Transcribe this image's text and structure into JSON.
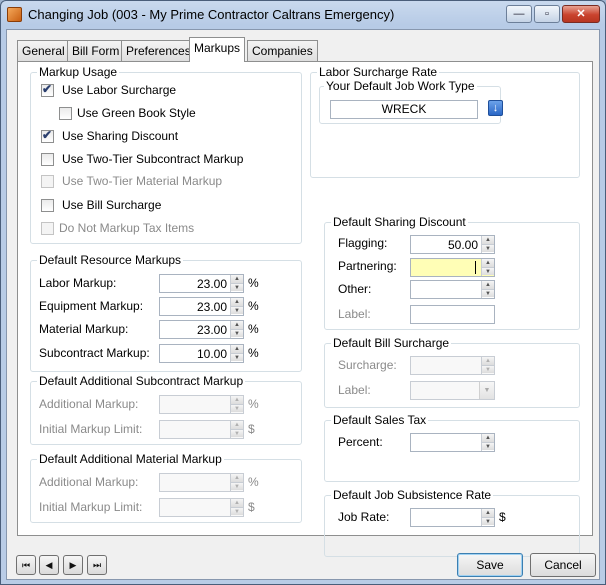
{
  "window": {
    "title": "Changing Job  (003 - My Prime Contractor Caltrans Emergency)",
    "minimize_glyph": "—",
    "maximize_glyph": "▫",
    "close_glyph": "✕"
  },
  "tabs": [
    {
      "label": "General",
      "active": false
    },
    {
      "label": "Bill Form",
      "active": false
    },
    {
      "label": "Preferences",
      "active": false
    },
    {
      "label": "Markups",
      "active": true
    },
    {
      "label": "Companies",
      "active": false
    }
  ],
  "markup_usage": {
    "legend": "Markup Usage",
    "items": [
      {
        "label": "Use Labor Surcharge",
        "checked": true,
        "enabled": true
      },
      {
        "label": "Use Green Book Style",
        "checked": false,
        "enabled": true
      },
      {
        "label": "Use Sharing Discount",
        "checked": true,
        "enabled": true
      },
      {
        "label": "Use Two-Tier Subcontract Markup",
        "checked": false,
        "enabled": true
      },
      {
        "label": "Use Two-Tier Material Markup",
        "checked": false,
        "enabled": false
      },
      {
        "label": "Use Bill Surcharge",
        "checked": false,
        "enabled": true
      },
      {
        "label": "Do Not Markup Tax Items",
        "checked": false,
        "enabled": false
      }
    ]
  },
  "resource_markups": {
    "legend": "Default Resource Markups",
    "rows": [
      {
        "label": "Labor Markup:",
        "value": "23.00",
        "unit": "%"
      },
      {
        "label": "Equipment Markup:",
        "value": "23.00",
        "unit": "%"
      },
      {
        "label": "Material Markup:",
        "value": "23.00",
        "unit": "%"
      },
      {
        "label": "Subcontract Markup:",
        "value": "10.00",
        "unit": "%"
      }
    ]
  },
  "additional_subcontract": {
    "legend": "Default Additional Subcontract Markup",
    "rows": [
      {
        "label": "Additional Markup:",
        "value": "",
        "unit": "%"
      },
      {
        "label": "Initial Markup Limit:",
        "value": "",
        "unit": "$"
      }
    ]
  },
  "additional_material": {
    "legend": "Default Additional Material Markup",
    "rows": [
      {
        "label": "Additional Markup:",
        "value": "",
        "unit": "%"
      },
      {
        "label": "Initial Markup Limit:",
        "value": "",
        "unit": "$"
      }
    ]
  },
  "labor_surcharge": {
    "legend": "Labor Surcharge Rate",
    "sublegend": "Your Default Job Work Type",
    "work_type": "WRECK",
    "lookup_glyph": "↓"
  },
  "sharing_discount": {
    "legend": "Default Sharing Discount",
    "rows": [
      {
        "label": "Flagging:",
        "value": "50.00"
      },
      {
        "label": "Partnering:",
        "value": ""
      },
      {
        "label": "Other:",
        "value": ""
      },
      {
        "label": "Label:",
        "value": ""
      }
    ]
  },
  "bill_surcharge": {
    "legend": "Default Bill Surcharge",
    "rows": [
      {
        "label": "Surcharge:",
        "value": ""
      },
      {
        "label": "Label:",
        "value": ""
      }
    ]
  },
  "sales_tax": {
    "legend": "Default Sales Tax",
    "label": "Percent:",
    "value": ""
  },
  "subsistence": {
    "legend": "Default Job Subsistence Rate",
    "label": "Job Rate:",
    "value": "",
    "unit": "$"
  },
  "navigation": {
    "first": "⏮",
    "prev": "◀",
    "next": "▶",
    "last": "⏭"
  },
  "buttons": {
    "save": "Save",
    "cancel": "Cancel"
  },
  "spin_glyphs": {
    "up": "▲",
    "down": "▼"
  },
  "check_glyph": "✔",
  "combo_glyph": "▼"
}
